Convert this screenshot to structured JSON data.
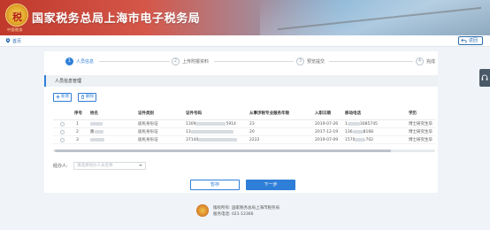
{
  "header": {
    "title": "国家税务总局上海市电子税务局",
    "logo_text": "中国税务",
    "brand_colors": {
      "red": "#c0392b",
      "blue": "#7fb2d6"
    }
  },
  "breadcrumb": {
    "home_label": "首页",
    "return_label": "返回"
  },
  "stepper": {
    "steps": [
      {
        "num": "1",
        "label": "人员信息",
        "active": true
      },
      {
        "num": "2",
        "label": "上传附报资料",
        "active": false
      },
      {
        "num": "3",
        "label": "预览提交",
        "active": false
      },
      {
        "num": "4",
        "label": "完成",
        "active": false
      }
    ]
  },
  "section": {
    "title": "人员信息管理"
  },
  "toolbar": {
    "add_label": "新增",
    "delete_label": "删除"
  },
  "table": {
    "columns": [
      "序号",
      "姓名",
      "证件类别",
      "证件号码",
      "从事涉税专业服务年限",
      "入职日期",
      "移动电话",
      "学历"
    ],
    "rows": [
      {
        "no": "1",
        "name": "",
        "id_type": "居民身份证",
        "id_no_prefix": "1309",
        "id_no_suffix": "5914",
        "years": "23",
        "hire_date": "2019-07-26",
        "phone_prefix": "1",
        "phone_suffix": "3085745",
        "edu": "博士研究生毕"
      },
      {
        "no": "2",
        "name": "路",
        "id_type": "居民身份证",
        "id_no_prefix": "13",
        "id_no_suffix": "",
        "years": "20",
        "hire_date": "2017-12-19",
        "phone_prefix": "136",
        "phone_suffix": "8168",
        "edu": "博士研究生毕"
      },
      {
        "no": "3",
        "name": "",
        "id_type": "居民身份证",
        "id_no_prefix": "37140",
        "id_no_suffix": "",
        "years": "2222",
        "hire_date": "2019-07-09",
        "phone_prefix": "1570",
        "phone_suffix": "702",
        "edu": "博士研究生毕"
      }
    ]
  },
  "agent": {
    "label": "经办人:",
    "placeholder": "请选择经办人员名称"
  },
  "actions": {
    "save_label": "暂存",
    "next_label": "下一步"
  },
  "footer": {
    "line1": "版权所有: 国家税务总局上海市税务局",
    "line2": "服务电话: 021-12366"
  },
  "accent_color": "#2f7fd8"
}
